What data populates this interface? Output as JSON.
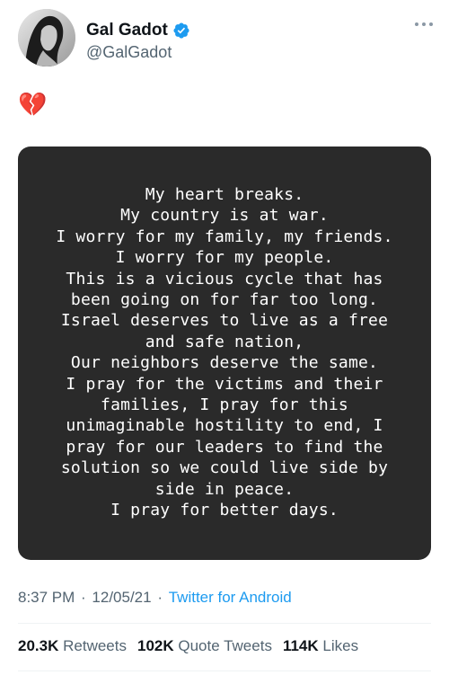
{
  "author": {
    "display_name": "Gal Gadot",
    "handle": "@GalGadot",
    "verified": true
  },
  "tweet": {
    "text_emoji": "💔",
    "image_statement": "My heart breaks.\nMy country is at war.\nI worry for my family, my friends.\nI worry for my people.\nThis is a vicious cycle that has\nbeen going on for far too long.\nIsrael deserves to live as a free\nand safe nation,\nOur neighbors deserve the same.\nI pray for the victims and their\nfamilies, I pray for this\nunimaginable hostility to end, I\npray for our leaders to find the\nsolution so we could live side by\nside in peace.\nI pray for better days.",
    "time": "8:37 PM",
    "date": "12/05/21",
    "source": "Twitter for Android"
  },
  "stats": {
    "retweets_count": "20.3K",
    "retweets_label": "Retweets",
    "quote_count": "102K",
    "quote_label": "Quote Tweets",
    "likes_count": "114K",
    "likes_label": "Likes"
  },
  "icons": {
    "verified": "verified-badge-icon",
    "more": "more-options-icon",
    "emoji": "broken-heart-emoji"
  },
  "colors": {
    "link": "#1d9bf0",
    "secondary_text": "#536471",
    "image_background": "#2a2a2a"
  }
}
